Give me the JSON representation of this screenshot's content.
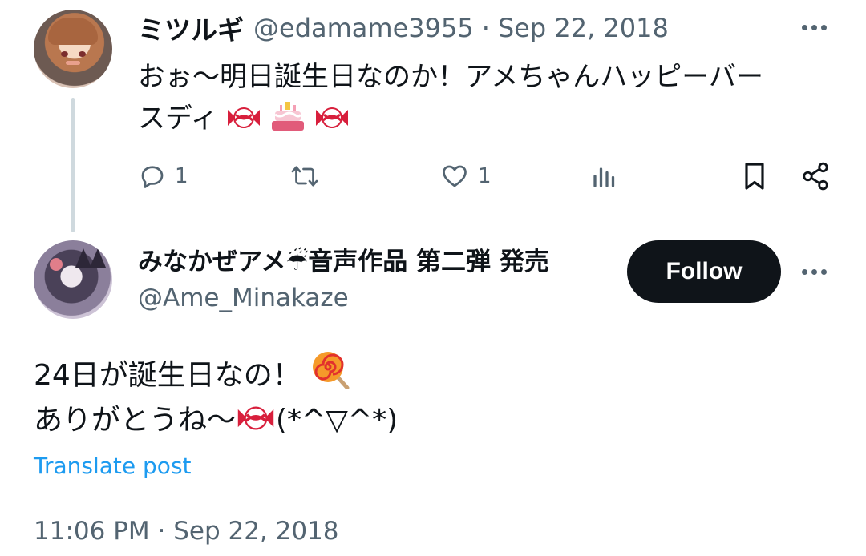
{
  "reply_tweet": {
    "author_name": "ミツルギ",
    "handle": "@edamame3955",
    "separator": "·",
    "date": "Sep 22, 2018",
    "text_line1": "おぉ〜明日誕生日なのか！アメちゃんハッピーバー",
    "text_line2": "スディ",
    "actions": {
      "reply_count": "1",
      "like_count": "1"
    }
  },
  "main_tweet": {
    "author_name": "みなかぜアメ☔音声作品 第二弾 発売",
    "handle": "@Ame_Minakaze",
    "follow_label": "Follow",
    "text_line1": "24日が誕生日なの！",
    "text_line2_a": "ありがとうね〜",
    "text_line2_b": "(*^▽^*)",
    "translate_label": "Translate post",
    "timestamp": "11:06 PM · Sep 22, 2018"
  },
  "colors": {
    "text": "#0f1419",
    "secondary": "#536471",
    "link": "#1d9bf0",
    "follow_bg": "#0f1419",
    "thread_line": "#cfd9de"
  },
  "icons": [
    "candy-icon",
    "birthday-cake-icon",
    "lollipop-icon",
    "umbrella-rain-icon",
    "reply-icon",
    "retweet-icon",
    "like-icon",
    "views-icon",
    "bookmark-icon",
    "share-icon",
    "more-icon"
  ]
}
